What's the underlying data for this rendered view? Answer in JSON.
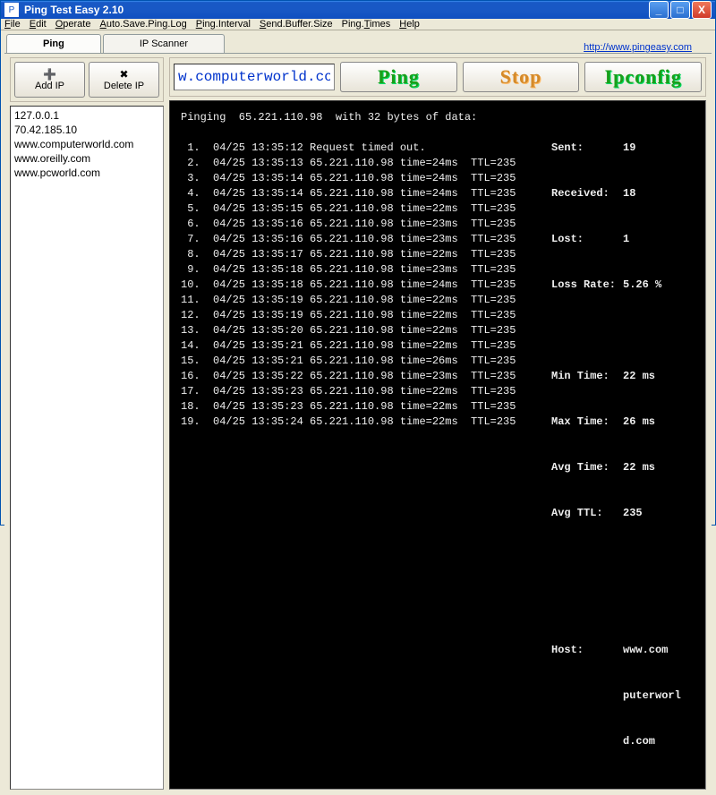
{
  "window": {
    "title": "Ping Test Easy 2.10"
  },
  "menu": {
    "file": "File",
    "edit": "Edit",
    "operate": "Operate",
    "autosave": "Auto.Save.Ping.Log",
    "interval": "Ping.Interval",
    "buffer": "Send.Buffer.Size",
    "times": "Ping.Times",
    "help": "Help"
  },
  "tabs": {
    "ping": "Ping",
    "ipscanner": "IP Scanner"
  },
  "link": "http://www.pingeasy.com",
  "toolbar": {
    "add_ip": "Add IP",
    "delete_ip": "Delete IP"
  },
  "ip_list": [
    "127.0.0.1",
    "70.42.185.10",
    "www.computerworld.com",
    "www.oreilly.com",
    "www.pcworld.com"
  ],
  "host_input": "w.computerworld.com",
  "buttons": {
    "ping": "Ping",
    "stop": "Stop",
    "ipconfig": "Ipconfig"
  },
  "console": {
    "header": "Pinging  65.221.110.98  with 32 bytes of data:",
    "lines": [
      " 1.  04/25 13:35:12 Request timed out.",
      " 2.  04/25 13:35:13 65.221.110.98 time=24ms  TTL=235",
      " 3.  04/25 13:35:14 65.221.110.98 time=24ms  TTL=235",
      " 4.  04/25 13:35:14 65.221.110.98 time=24ms  TTL=235",
      " 5.  04/25 13:35:15 65.221.110.98 time=22ms  TTL=235",
      " 6.  04/25 13:35:16 65.221.110.98 time=23ms  TTL=235",
      " 7.  04/25 13:35:16 65.221.110.98 time=23ms  TTL=235",
      " 8.  04/25 13:35:17 65.221.110.98 time=22ms  TTL=235",
      " 9.  04/25 13:35:18 65.221.110.98 time=23ms  TTL=235",
      "10.  04/25 13:35:18 65.221.110.98 time=24ms  TTL=235",
      "11.  04/25 13:35:19 65.221.110.98 time=22ms  TTL=235",
      "12.  04/25 13:35:19 65.221.110.98 time=22ms  TTL=235",
      "13.  04/25 13:35:20 65.221.110.98 time=22ms  TTL=235",
      "14.  04/25 13:35:21 65.221.110.98 time=22ms  TTL=235",
      "15.  04/25 13:35:21 65.221.110.98 time=26ms  TTL=235",
      "16.  04/25 13:35:22 65.221.110.98 time=23ms  TTL=235",
      "17.  04/25 13:35:23 65.221.110.98 time=22ms  TTL=235",
      "18.  04/25 13:35:23 65.221.110.98 time=22ms  TTL=235",
      "19.  04/25 13:35:24 65.221.110.98 time=22ms  TTL=235"
    ]
  },
  "stats": {
    "sent_label": "Sent:",
    "sent": "19",
    "recv_label": "Received:",
    "recv": "18",
    "lost_label": "Lost:",
    "lost": "1",
    "rate_label": "Loss Rate:",
    "rate": "5.26 %",
    "mint_label": "Min Time:",
    "mint": "22 ms",
    "maxt_label": "Max Time:",
    "maxt": "26 ms",
    "avgt_label": "Avg Time:",
    "avgt": "22 ms",
    "attl_label": "Avg TTL:",
    "attl": "235",
    "host_label": "Host:",
    "host1": "www.com",
    "host2": "puterworl",
    "host3": "d.com"
  }
}
